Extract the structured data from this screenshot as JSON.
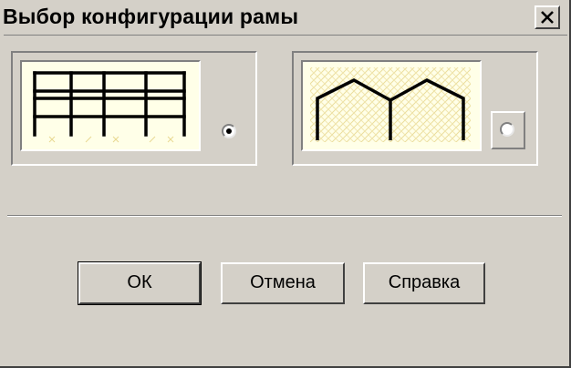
{
  "dialog": {
    "title": "Выбор конфигурации рамы",
    "close_glyph": "×"
  },
  "options": [
    {
      "name": "multi-storey-frame",
      "selected": true
    },
    {
      "name": "gable-portal-frame",
      "selected": false
    }
  ],
  "buttons": {
    "ok": "ОК",
    "cancel": "Отмена",
    "help": "Справка"
  },
  "colors": {
    "face": "#d4d0c8",
    "thumb_bg": "#ffffe8",
    "frame_line": "#000000"
  }
}
